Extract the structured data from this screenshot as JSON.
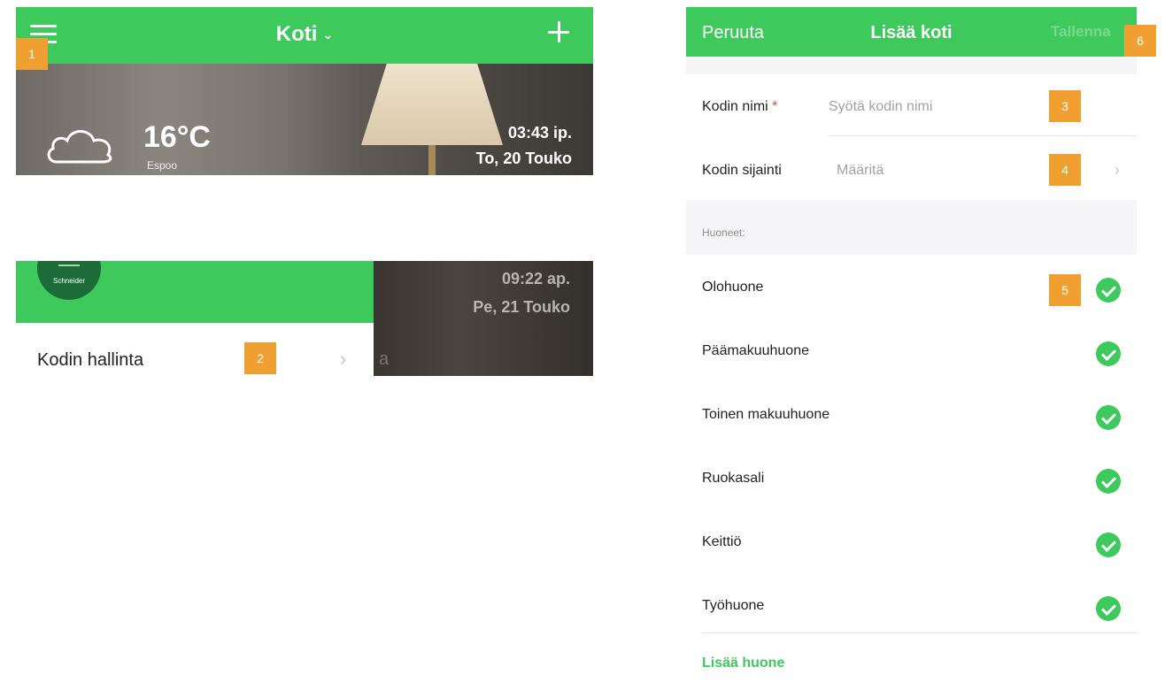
{
  "badges": {
    "b1": "1",
    "b2": "2",
    "b3": "3",
    "b4": "4",
    "b5": "5",
    "b6": "6"
  },
  "home_header": {
    "title": "Koti",
    "temperature": "16°C",
    "city": "Espoo",
    "time": "03:43 ip.",
    "date": "To, 20 Touko",
    "icons": [
      "hamburger-menu-icon",
      "chevron-down-icon",
      "plus-icon",
      "cloud-icon"
    ]
  },
  "side_menu": {
    "avatar_text": "Schneider",
    "time": "09:22 ap.",
    "date": "Pe, 21 Touko",
    "item_label": "Kodin hallinta",
    "fade_text": "a"
  },
  "add_home": {
    "cancel": "Peruuta",
    "title": "Lisää koti",
    "save": "Tallenna",
    "name_label": "Kodin nimi",
    "required_mark": "*",
    "name_placeholder": "Syötä kodin nimi",
    "location_label": "Kodin sijainti",
    "location_value": "Määritä",
    "rooms_header": "Huoneet:",
    "rooms": [
      "Olohuone",
      "Päämakuuhuone",
      "Toinen makuuhuone",
      "Ruokasali",
      "Keittiö",
      "Työhuone"
    ],
    "add_room": "Lisää huone"
  },
  "colors": {
    "brand_green": "#3dc95c",
    "badge_orange": "#f0a030",
    "required_red": "#e84c3d"
  }
}
